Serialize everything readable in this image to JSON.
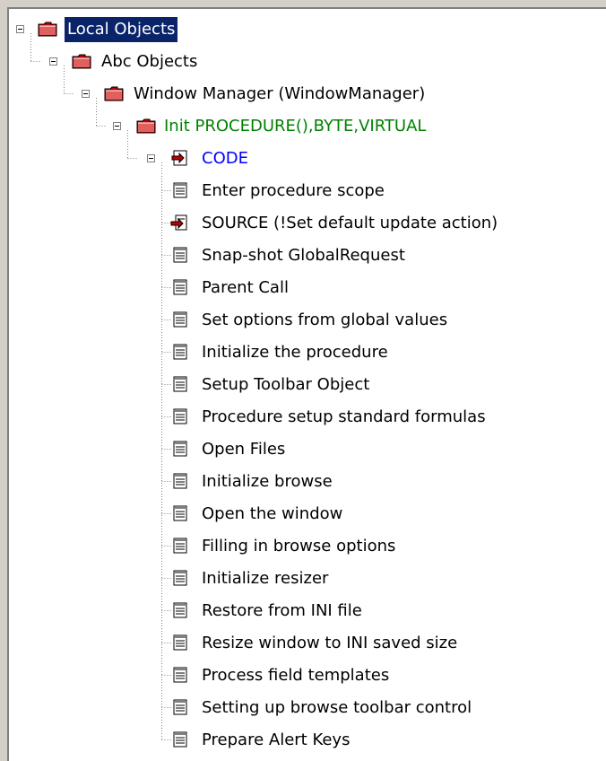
{
  "tree": {
    "root": {
      "label": "Local Objects",
      "icon": "folder-icon"
    },
    "abc": {
      "label": "Abc Objects",
      "icon": "folder-icon"
    },
    "wm": {
      "label": "Window Manager (WindowManager)",
      "icon": "folder-icon"
    },
    "init": {
      "label": "Init PROCEDURE(),BYTE,VIRTUAL",
      "icon": "folder-icon",
      "color": "#008000"
    },
    "code": {
      "label": "CODE",
      "icon": "code-embed-icon",
      "color": "#0000ff"
    },
    "items": [
      {
        "label": "Enter procedure scope",
        "icon": "document-icon"
      },
      {
        "label": "SOURCE (!Set default update action)",
        "icon": "source-embed-icon"
      },
      {
        "label": "Snap-shot GlobalRequest",
        "icon": "document-icon"
      },
      {
        "label": "Parent Call",
        "icon": "document-icon"
      },
      {
        "label": "Set options from global values",
        "icon": "document-icon"
      },
      {
        "label": "Initialize the procedure",
        "icon": "document-icon"
      },
      {
        "label": "Setup Toolbar Object",
        "icon": "document-icon"
      },
      {
        "label": "Procedure setup standard formulas",
        "icon": "document-icon"
      },
      {
        "label": "Open Files",
        "icon": "document-icon"
      },
      {
        "label": "Initialize browse",
        "icon": "document-icon"
      },
      {
        "label": "Open the window",
        "icon": "document-icon"
      },
      {
        "label": "Filling in browse options",
        "icon": "document-icon"
      },
      {
        "label": "Initialize resizer",
        "icon": "document-icon"
      },
      {
        "label": "Restore from INI file",
        "icon": "document-icon"
      },
      {
        "label": "Resize window to INI saved size",
        "icon": "document-icon"
      },
      {
        "label": "Process field templates",
        "icon": "document-icon"
      },
      {
        "label": "Setting up browse toolbar control",
        "icon": "document-icon"
      },
      {
        "label": "Prepare Alert Keys",
        "icon": "document-icon"
      }
    ]
  },
  "colors": {
    "selection": "#0a246a",
    "procedure": "#008000",
    "code": "#0000ff",
    "folder": "#c00000"
  }
}
